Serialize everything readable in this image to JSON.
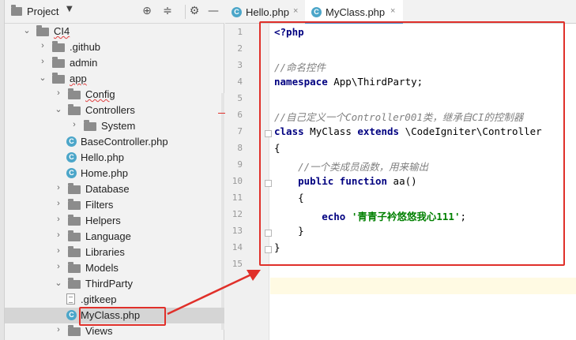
{
  "project_panel": {
    "title": "Project",
    "dropdown": "▼",
    "header_icons": {
      "locate": "⊕",
      "collapse": "≑",
      "settings": "⚙",
      "hide": "—"
    },
    "tree": [
      {
        "label": "CI4",
        "depth": 0,
        "type": "folder",
        "expanded": true,
        "wavy": true
      },
      {
        "label": ".github",
        "depth": 1,
        "type": "folder",
        "expanded": false
      },
      {
        "label": "admin",
        "depth": 1,
        "type": "folder",
        "expanded": false
      },
      {
        "label": "app",
        "depth": 1,
        "type": "folder",
        "expanded": true,
        "wavy": true
      },
      {
        "label": "Config",
        "depth": 2,
        "type": "folder",
        "expanded": false,
        "wavy": true
      },
      {
        "label": "Controllers",
        "depth": 2,
        "type": "folder",
        "expanded": true
      },
      {
        "label": "System",
        "depth": 3,
        "type": "folder",
        "expanded": false
      },
      {
        "label": "BaseController.php",
        "depth": 3,
        "type": "php"
      },
      {
        "label": "Hello.php",
        "depth": 3,
        "type": "php"
      },
      {
        "label": "Home.php",
        "depth": 3,
        "type": "php"
      },
      {
        "label": "Database",
        "depth": 2,
        "type": "folder",
        "expanded": false
      },
      {
        "label": "Filters",
        "depth": 2,
        "type": "folder",
        "expanded": false
      },
      {
        "label": "Helpers",
        "depth": 2,
        "type": "folder",
        "expanded": false
      },
      {
        "label": "Language",
        "depth": 2,
        "type": "folder",
        "expanded": false
      },
      {
        "label": "Libraries",
        "depth": 2,
        "type": "folder",
        "expanded": false
      },
      {
        "label": "Models",
        "depth": 2,
        "type": "folder",
        "expanded": false
      },
      {
        "label": "ThirdParty",
        "depth": 2,
        "type": "folder",
        "expanded": true
      },
      {
        "label": ".gitkeep",
        "depth": 3,
        "type": "text"
      },
      {
        "label": "MyClass.php",
        "depth": 3,
        "type": "php",
        "selected": true
      },
      {
        "label": "Views",
        "depth": 2,
        "type": "folder",
        "expanded": false
      }
    ]
  },
  "editor": {
    "tabs": [
      {
        "label": "Hello.php",
        "close": "×",
        "active": false
      },
      {
        "label": "MyClass.php",
        "close": "×",
        "active": true
      }
    ],
    "php_glyph": "C",
    "line_numbers": [
      "1",
      "2",
      "3",
      "4",
      "5",
      "6",
      "7",
      "8",
      "9",
      "10",
      "11",
      "12",
      "13",
      "14",
      "15"
    ],
    "code": {
      "l1": "<?php",
      "l3": "//命名控件",
      "l4_kw": "namespace",
      "l4_rest": " App\\ThirdParty;",
      "l6": "//自己定义一个Controller001类，继承自CI的控制器",
      "l7_kw1": "class",
      "l7_name": " MyClass ",
      "l7_kw2": "extends",
      "l7_rest": " \\CodeIgniter\\Controller",
      "l8": "{",
      "l9": "    //一个类成员函数，用来输出",
      "l10_kw1": "    public",
      "l10_sp": " ",
      "l10_kw2": "function",
      "l10_rest": " aa()",
      "l11": "    {",
      "l12_kw": "        echo",
      "l12_sp": " ",
      "l12_str": "'青青子衿悠悠我心111'",
      "l12_end": ";",
      "l13": "    }",
      "l14": "}"
    }
  },
  "annotation_color": "#e0302a"
}
